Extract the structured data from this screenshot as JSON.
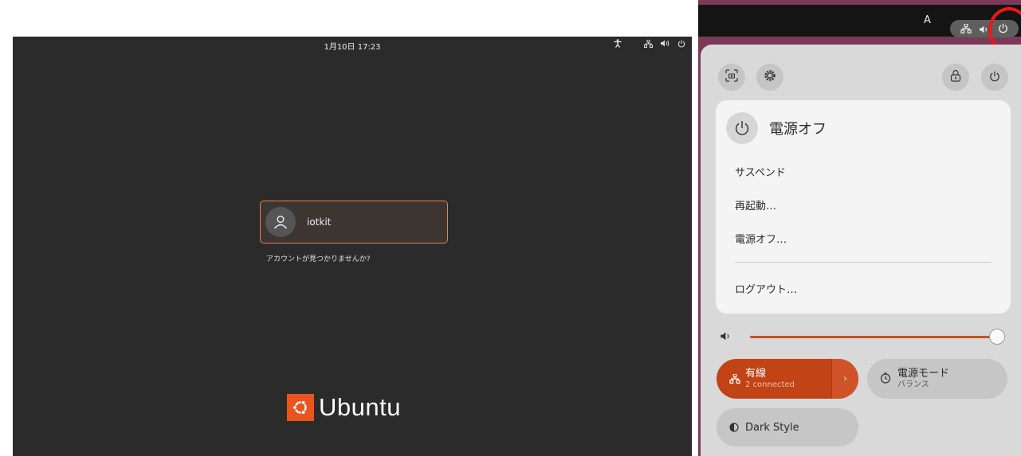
{
  "login": {
    "datetime": "1月10日 17:23",
    "user_name": "iotkit",
    "not_listed": "アカウントが見つかりませんか?",
    "brand": "Ubuntu"
  },
  "quick_settings": {
    "topbar_indicator": "A",
    "power_menu": {
      "title": "電源オフ",
      "items": [
        "サスペンド",
        "再起動…",
        "電源オフ…",
        "ログアウト…"
      ]
    },
    "volume_level": 1.0,
    "tiles": {
      "wired": {
        "title": "有線",
        "subtitle": "2 connected",
        "arrow": "›"
      },
      "power_mode": {
        "title": "電源モード",
        "subtitle": "バランス"
      },
      "dark_style": {
        "title": "Dark Style"
      }
    }
  },
  "colors": {
    "accent": "#e95420",
    "wired_tile": "#c14316",
    "highlight_ring": "#e8191a"
  },
  "icons": [
    "accessibility-icon",
    "network-icon",
    "volume-icon",
    "power-icon",
    "user-avatar-icon",
    "screenshot-icon",
    "settings-gear-icon",
    "lock-icon",
    "power-mode-icon",
    "dark-style-icon"
  ]
}
